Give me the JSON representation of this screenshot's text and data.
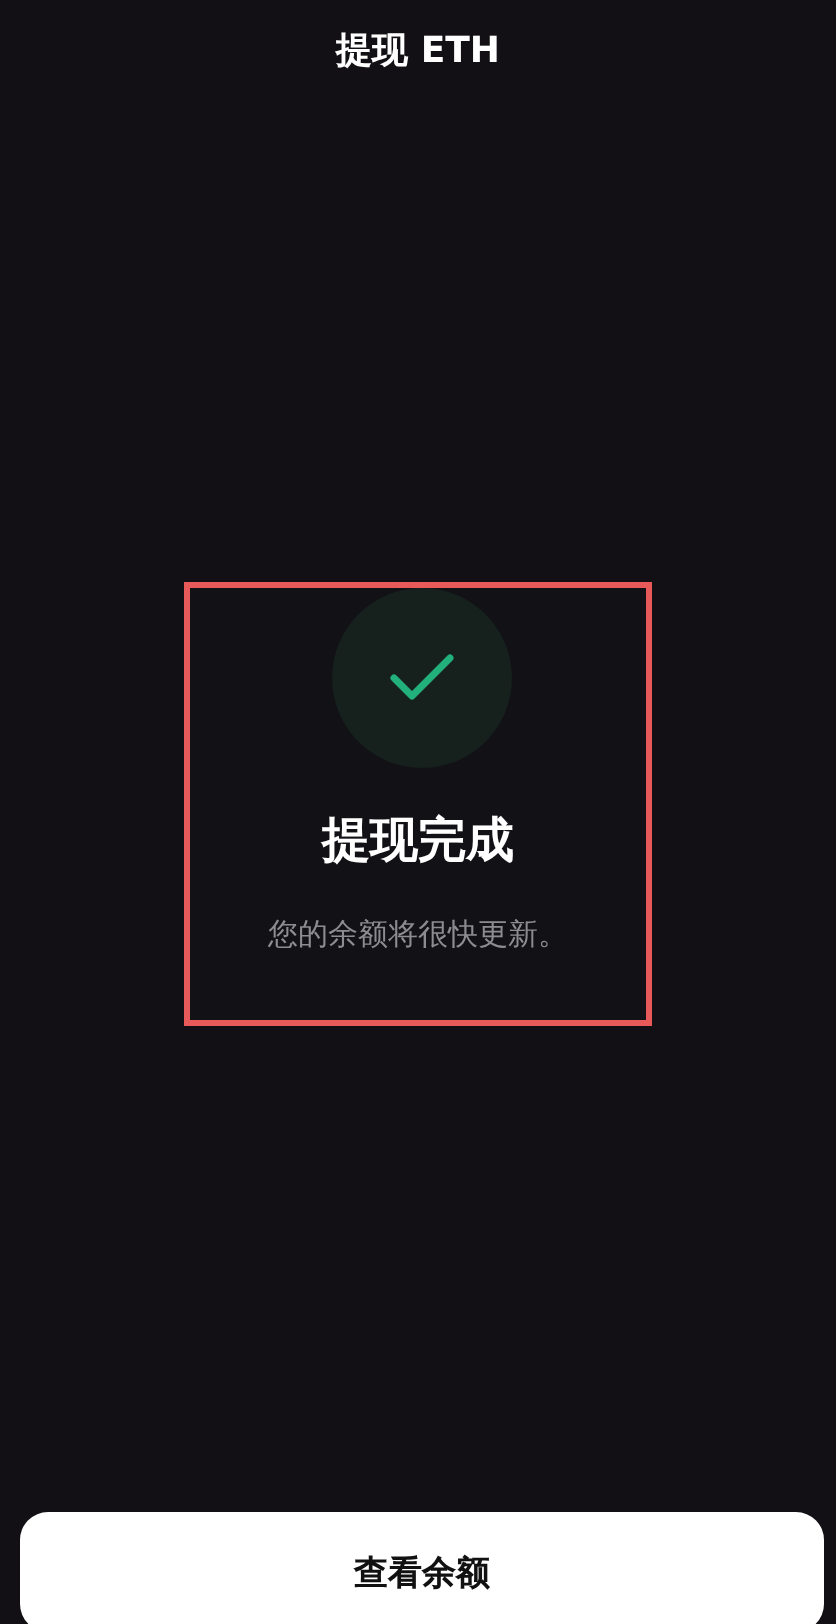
{
  "header": {
    "title": "提现 ETH"
  },
  "result": {
    "succeeded": true,
    "title": "提现完成",
    "message": "您的余额将很快更新。",
    "highlighted": true
  },
  "button": {
    "label": "查看余额"
  }
}
